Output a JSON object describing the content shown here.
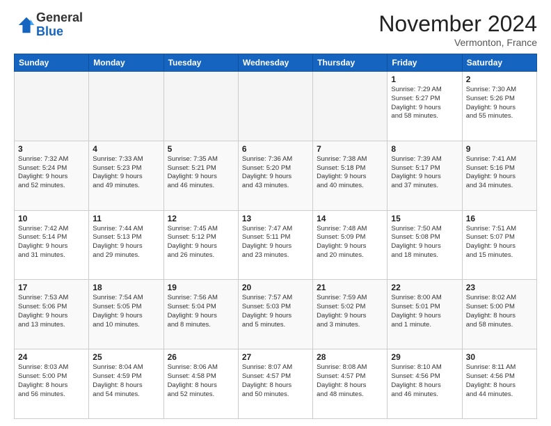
{
  "header": {
    "logo_general": "General",
    "logo_blue": "Blue",
    "month_title": "November 2024",
    "location": "Vermonton, France"
  },
  "weekdays": [
    "Sunday",
    "Monday",
    "Tuesday",
    "Wednesday",
    "Thursday",
    "Friday",
    "Saturday"
  ],
  "weeks": [
    [
      {
        "day": "",
        "info": ""
      },
      {
        "day": "",
        "info": ""
      },
      {
        "day": "",
        "info": ""
      },
      {
        "day": "",
        "info": ""
      },
      {
        "day": "",
        "info": ""
      },
      {
        "day": "1",
        "info": "Sunrise: 7:29 AM\nSunset: 5:27 PM\nDaylight: 9 hours\nand 58 minutes."
      },
      {
        "day": "2",
        "info": "Sunrise: 7:30 AM\nSunset: 5:26 PM\nDaylight: 9 hours\nand 55 minutes."
      }
    ],
    [
      {
        "day": "3",
        "info": "Sunrise: 7:32 AM\nSunset: 5:24 PM\nDaylight: 9 hours\nand 52 minutes."
      },
      {
        "day": "4",
        "info": "Sunrise: 7:33 AM\nSunset: 5:23 PM\nDaylight: 9 hours\nand 49 minutes."
      },
      {
        "day": "5",
        "info": "Sunrise: 7:35 AM\nSunset: 5:21 PM\nDaylight: 9 hours\nand 46 minutes."
      },
      {
        "day": "6",
        "info": "Sunrise: 7:36 AM\nSunset: 5:20 PM\nDaylight: 9 hours\nand 43 minutes."
      },
      {
        "day": "7",
        "info": "Sunrise: 7:38 AM\nSunset: 5:18 PM\nDaylight: 9 hours\nand 40 minutes."
      },
      {
        "day": "8",
        "info": "Sunrise: 7:39 AM\nSunset: 5:17 PM\nDaylight: 9 hours\nand 37 minutes."
      },
      {
        "day": "9",
        "info": "Sunrise: 7:41 AM\nSunset: 5:16 PM\nDaylight: 9 hours\nand 34 minutes."
      }
    ],
    [
      {
        "day": "10",
        "info": "Sunrise: 7:42 AM\nSunset: 5:14 PM\nDaylight: 9 hours\nand 31 minutes."
      },
      {
        "day": "11",
        "info": "Sunrise: 7:44 AM\nSunset: 5:13 PM\nDaylight: 9 hours\nand 29 minutes."
      },
      {
        "day": "12",
        "info": "Sunrise: 7:45 AM\nSunset: 5:12 PM\nDaylight: 9 hours\nand 26 minutes."
      },
      {
        "day": "13",
        "info": "Sunrise: 7:47 AM\nSunset: 5:11 PM\nDaylight: 9 hours\nand 23 minutes."
      },
      {
        "day": "14",
        "info": "Sunrise: 7:48 AM\nSunset: 5:09 PM\nDaylight: 9 hours\nand 20 minutes."
      },
      {
        "day": "15",
        "info": "Sunrise: 7:50 AM\nSunset: 5:08 PM\nDaylight: 9 hours\nand 18 minutes."
      },
      {
        "day": "16",
        "info": "Sunrise: 7:51 AM\nSunset: 5:07 PM\nDaylight: 9 hours\nand 15 minutes."
      }
    ],
    [
      {
        "day": "17",
        "info": "Sunrise: 7:53 AM\nSunset: 5:06 PM\nDaylight: 9 hours\nand 13 minutes."
      },
      {
        "day": "18",
        "info": "Sunrise: 7:54 AM\nSunset: 5:05 PM\nDaylight: 9 hours\nand 10 minutes."
      },
      {
        "day": "19",
        "info": "Sunrise: 7:56 AM\nSunset: 5:04 PM\nDaylight: 9 hours\nand 8 minutes."
      },
      {
        "day": "20",
        "info": "Sunrise: 7:57 AM\nSunset: 5:03 PM\nDaylight: 9 hours\nand 5 minutes."
      },
      {
        "day": "21",
        "info": "Sunrise: 7:59 AM\nSunset: 5:02 PM\nDaylight: 9 hours\nand 3 minutes."
      },
      {
        "day": "22",
        "info": "Sunrise: 8:00 AM\nSunset: 5:01 PM\nDaylight: 9 hours\nand 1 minute."
      },
      {
        "day": "23",
        "info": "Sunrise: 8:02 AM\nSunset: 5:00 PM\nDaylight: 8 hours\nand 58 minutes."
      }
    ],
    [
      {
        "day": "24",
        "info": "Sunrise: 8:03 AM\nSunset: 5:00 PM\nDaylight: 8 hours\nand 56 minutes."
      },
      {
        "day": "25",
        "info": "Sunrise: 8:04 AM\nSunset: 4:59 PM\nDaylight: 8 hours\nand 54 minutes."
      },
      {
        "day": "26",
        "info": "Sunrise: 8:06 AM\nSunset: 4:58 PM\nDaylight: 8 hours\nand 52 minutes."
      },
      {
        "day": "27",
        "info": "Sunrise: 8:07 AM\nSunset: 4:57 PM\nDaylight: 8 hours\nand 50 minutes."
      },
      {
        "day": "28",
        "info": "Sunrise: 8:08 AM\nSunset: 4:57 PM\nDaylight: 8 hours\nand 48 minutes."
      },
      {
        "day": "29",
        "info": "Sunrise: 8:10 AM\nSunset: 4:56 PM\nDaylight: 8 hours\nand 46 minutes."
      },
      {
        "day": "30",
        "info": "Sunrise: 8:11 AM\nSunset: 4:56 PM\nDaylight: 8 hours\nand 44 minutes."
      }
    ]
  ]
}
